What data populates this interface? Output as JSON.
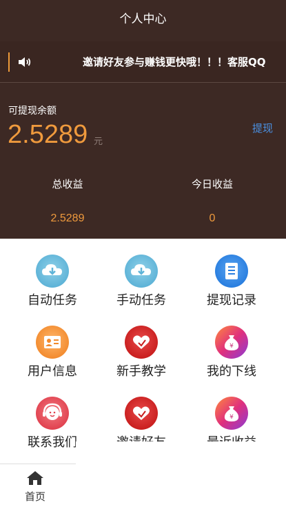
{
  "header": {
    "title": "个人中心"
  },
  "notice": {
    "icon": "speaker-icon",
    "text": "邀请好友参与赚钱更快哦！！！客服QQ"
  },
  "balance": {
    "label": "可提现余额",
    "value": "2.5289",
    "unit": "元",
    "withdraw_label": "提现"
  },
  "stats": [
    {
      "label": "总收益",
      "value": "2.5289"
    },
    {
      "label": "今日收益",
      "value": "0"
    }
  ],
  "menu": [
    {
      "label": "自动任务",
      "icon": "cloud-download-icon"
    },
    {
      "label": "手动任务",
      "icon": "cloud-download-icon"
    },
    {
      "label": "提现记录",
      "icon": "document-icon"
    },
    {
      "label": "用户信息",
      "icon": "user-card-icon"
    },
    {
      "label": "新手教学",
      "icon": "heart-icon"
    },
    {
      "label": "我的下线",
      "icon": "money-bag-icon"
    },
    {
      "label": "联系我们",
      "icon": "customer-service-icon"
    },
    {
      "label": "邀请好友",
      "icon": "heart-icon"
    },
    {
      "label": "最近收益",
      "icon": "money-bag-icon"
    }
  ],
  "tabbar": {
    "home_label": "首页",
    "home_icon": "home-icon"
  },
  "colors": {
    "header_bg": "#3d2924",
    "accent": "#ef9a3d",
    "link": "#4a90e2"
  }
}
